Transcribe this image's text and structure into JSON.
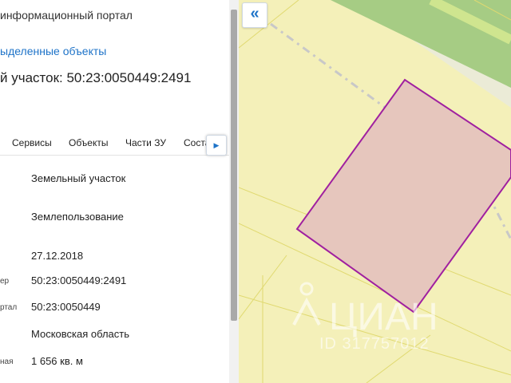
{
  "panel": {
    "portal_title": "информационный портал",
    "selected_objects_link": "ыделенные объекты",
    "parcel_title": "й участок: 50:23:0050449:2491",
    "tabs": [
      "Сервисы",
      "Объекты",
      "Части ЗУ",
      "Соста"
    ],
    "rows": [
      {
        "label": "",
        "value": "Земельный участок"
      },
      {
        "label": "",
        "value": "Землепользование"
      },
      {
        "label": "",
        "value": "27.12.2018"
      },
      {
        "label": "ер",
        "value": "50:23:0050449:2491"
      },
      {
        "label": "ртал",
        "value": "50:23:0050449"
      },
      {
        "label": "",
        "value": "Московская область"
      },
      {
        "label": "ная",
        "value": "1 656 кв. м"
      }
    ]
  },
  "icons": {
    "tab_scroll": "caret-right-icon",
    "collapse": "double-chevron-left-icon"
  },
  "map": {
    "collapse_glyph": "«",
    "watermark": "ЦИАН",
    "watermark_id": "ID 317757012"
  },
  "colors": {
    "link": "#1e73c8",
    "parcel_fill": "#e6c6bd",
    "parcel_stroke": "#a020a0",
    "map_base": "#f4f0b9",
    "green_strip": "#a6cc84"
  }
}
